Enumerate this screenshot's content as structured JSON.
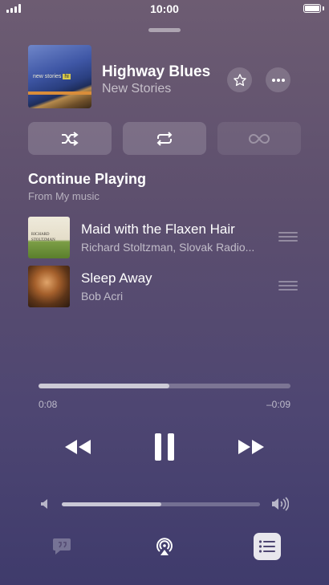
{
  "status_bar": {
    "time": "10:00"
  },
  "now_playing": {
    "title": "Highway Blues",
    "artist": "New Stories"
  },
  "album_art": {
    "text_top": "new stories",
    "text_block": "hi"
  },
  "queue_section": {
    "title": "Continue Playing",
    "subtitle": "From My music"
  },
  "queue": [
    {
      "title": "Maid with the Flaxen Hair",
      "artist": "Richard Stoltzman, Slovak Radio...",
      "thumb_text": [
        "RICHARD",
        "STOLTZMAN"
      ]
    },
    {
      "title": "Sleep Away",
      "artist": "Bob Acri"
    }
  ],
  "playback": {
    "elapsed": "0:08",
    "remaining": "–0:09",
    "progress_fraction": 0.52
  },
  "volume": {
    "level_fraction": 0.5
  },
  "icons": {
    "star": "star-icon",
    "more": "more-icon",
    "shuffle": "shuffle-icon",
    "repeat": "repeat-icon",
    "autoplay": "infinity-icon",
    "rewind": "rewind-icon",
    "pause": "pause-icon",
    "forward": "fast-forward-icon",
    "volume_low": "volume-low-icon",
    "volume_high": "volume-high-icon",
    "lyrics": "lyrics-icon",
    "airplay": "airplay-icon",
    "queue": "queue-icon"
  },
  "colors": {
    "background_top": "#6d5c72",
    "background_bottom": "#3f3b6c",
    "accent": "#ffffff"
  }
}
